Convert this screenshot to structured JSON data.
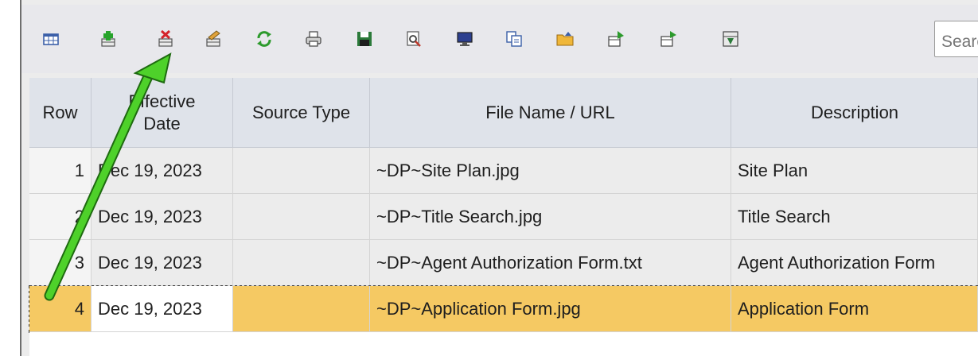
{
  "toolbar": {
    "search_placeholder": "Search",
    "buttons": [
      {
        "name": "grid-view-icon"
      },
      {
        "name": "add-row-icon"
      },
      {
        "name": "delete-row-icon"
      },
      {
        "name": "edit-row-icon"
      },
      {
        "name": "refresh-icon"
      },
      {
        "name": "print-icon"
      },
      {
        "name": "save-icon"
      },
      {
        "name": "preview-icon"
      },
      {
        "name": "monitor-icon"
      },
      {
        "name": "copy-icon"
      },
      {
        "name": "open-folder-icon"
      },
      {
        "name": "export-icon"
      },
      {
        "name": "export-alt-icon"
      },
      {
        "name": "import-icon"
      }
    ]
  },
  "grid": {
    "columns": [
      {
        "label": "Row"
      },
      {
        "label": "Effective Date"
      },
      {
        "label": "Source Type"
      },
      {
        "label": "File Name / URL"
      },
      {
        "label": "Description"
      }
    ],
    "rows": [
      {
        "row": "1",
        "date": "Dec 19, 2023",
        "source": "",
        "file": "~DP~Site Plan.jpg",
        "desc": "Site Plan"
      },
      {
        "row": "2",
        "date": "Dec 19, 2023",
        "source": "",
        "file": "~DP~Title Search.jpg",
        "desc": "Title Search"
      },
      {
        "row": "3",
        "date": "Dec 19, 2023",
        "source": "",
        "file": "~DP~Agent Authorization Form.txt",
        "desc": "Agent Authorization Form"
      },
      {
        "row": "4",
        "date": "Dec 19, 2023",
        "source": "",
        "file": "~DP~Application Form.jpg",
        "desc": "Application Form"
      }
    ],
    "selected_row": "4"
  },
  "colors": {
    "selected_row": "#f5c963",
    "header_bg": "#dfe3ea",
    "arrow": "#4ed12a"
  }
}
